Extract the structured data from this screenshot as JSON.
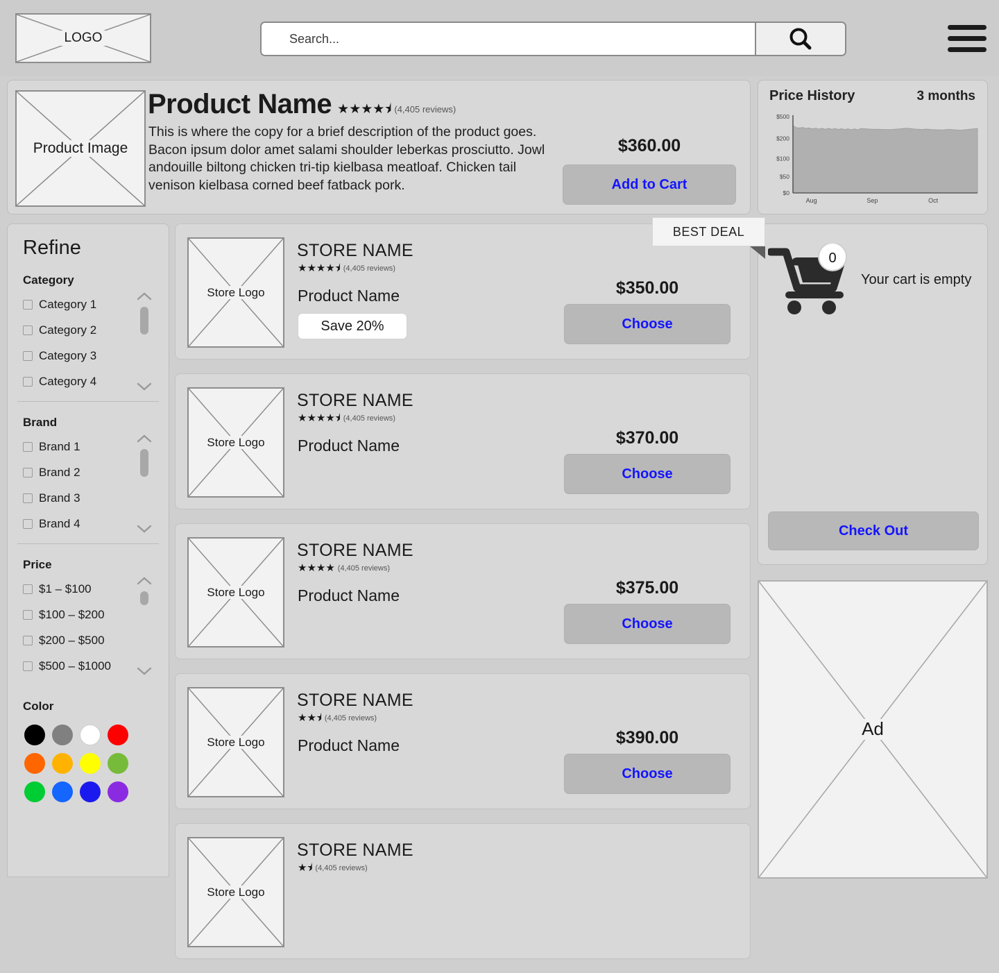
{
  "header": {
    "logo_label": "LOGO",
    "search_placeholder": "Search...",
    "search_value": "",
    "search_icon": "search-icon",
    "menu_icon": "hamburger-menu-icon"
  },
  "product": {
    "image_label": "Product Image",
    "title": "Product Name",
    "stars": "★★★★⯨",
    "reviews": "(4,405 reviews)",
    "rating_value": 4.5,
    "description": "This is where the copy for a brief description of the product goes. Bacon ipsum dolor amet salami shoulder leberkas prosciutto. Jowl andouille biltong chicken tri-tip kielbasa meatloaf. Chicken tail venison kielbasa corned beef fatback pork.",
    "price": "$360.00",
    "add_to_cart_label": "Add to Cart"
  },
  "price_history": {
    "title": "Price History",
    "range_label": "3 months"
  },
  "chart_data": {
    "type": "area",
    "title": "Price History",
    "subtitle": "3 months",
    "xlabel": "",
    "ylabel": "",
    "grid": false,
    "legend": "none",
    "ytick_labels": [
      "$500",
      "$200",
      "$100",
      "$50",
      "$0"
    ],
    "ytick_values": [
      500,
      200,
      100,
      50,
      0
    ],
    "xtick_labels": [
      "Aug",
      "Sep",
      "Oct"
    ],
    "ylim": [
      0,
      500
    ],
    "series": [
      {
        "name": "Price",
        "values": [
          380,
          350,
          345,
          352,
          338,
          346,
          332,
          344,
          330,
          342,
          328,
          340,
          327,
          338,
          325,
          336,
          324,
          334,
          322,
          333,
          321,
          340,
          336,
          332,
          330,
          328,
          327,
          326,
          325,
          324,
          323,
          326,
          330,
          334,
          338,
          342,
          339,
          334,
          330,
          327,
          325,
          330,
          327,
          324,
          322,
          320,
          318,
          322,
          326,
          324,
          320,
          318,
          316,
          320,
          325,
          330,
          334,
          338
        ]
      }
    ]
  },
  "sidebar": {
    "title": "Refine",
    "facets": [
      {
        "name": "Category",
        "label": "Category",
        "options": [
          "Category 1",
          "Category 2",
          "Category 3",
          "Category 4"
        ],
        "scroll": "large"
      },
      {
        "name": "Brand",
        "label": "Brand",
        "options": [
          "Brand 1",
          "Brand 2",
          "Brand 3",
          "Brand 4"
        ],
        "scroll": "large"
      },
      {
        "name": "Price",
        "label": "Price",
        "options": [
          "$1 – $100",
          "$100 – $200",
          "$200 – $500",
          "$500 – $1000"
        ],
        "scroll": "small"
      }
    ],
    "color": {
      "label": "Color",
      "swatches": [
        "#000000",
        "#808080",
        "#ffffff",
        "#ff0000",
        "#ff6600",
        "#ffb300",
        "#ffff00",
        "#77bb3b",
        "#00cc33",
        "#1565ff",
        "#1a1aee",
        "#8a2be2"
      ]
    }
  },
  "store_list": {
    "logo_label": "Store Logo",
    "choose_label": "Choose",
    "best_deal_label": "BEST DEAL",
    "items": [
      {
        "store_name": "STORE NAME",
        "stars": "★★★★⯨",
        "rating_value": 4.5,
        "reviews": "(4,405 reviews)",
        "product_name": "Product Name",
        "price": "$350.00",
        "badge": "Save 20%",
        "best_deal": true
      },
      {
        "store_name": "STORE NAME",
        "stars": "★★★★⯨",
        "rating_value": 4.5,
        "reviews": "(4,405 reviews)",
        "product_name": "Product Name",
        "price": "$370.00",
        "badge": "",
        "best_deal": false
      },
      {
        "store_name": "STORE NAME",
        "stars": "★★★★",
        "rating_value": 4,
        "reviews": "(4,405 reviews)",
        "product_name": "Product Name",
        "price": "$375.00",
        "badge": "",
        "best_deal": false
      },
      {
        "store_name": "STORE NAME",
        "stars": "★★⯨",
        "rating_value": 2.5,
        "reviews": "(4,405 reviews)",
        "product_name": "Product Name",
        "price": "$390.00",
        "badge": "",
        "best_deal": false
      },
      {
        "store_name": "STORE NAME",
        "stars": "★⯨",
        "rating_value": 1.5,
        "reviews": "(4,405 reviews)",
        "product_name": "",
        "price": "",
        "badge": "",
        "best_deal": false
      }
    ]
  },
  "cart": {
    "icon": "shopping-cart-icon",
    "count": "0",
    "empty_message": "Your cart is empty",
    "checkout_label": "Check Out"
  },
  "ad": {
    "label": "Ad"
  }
}
